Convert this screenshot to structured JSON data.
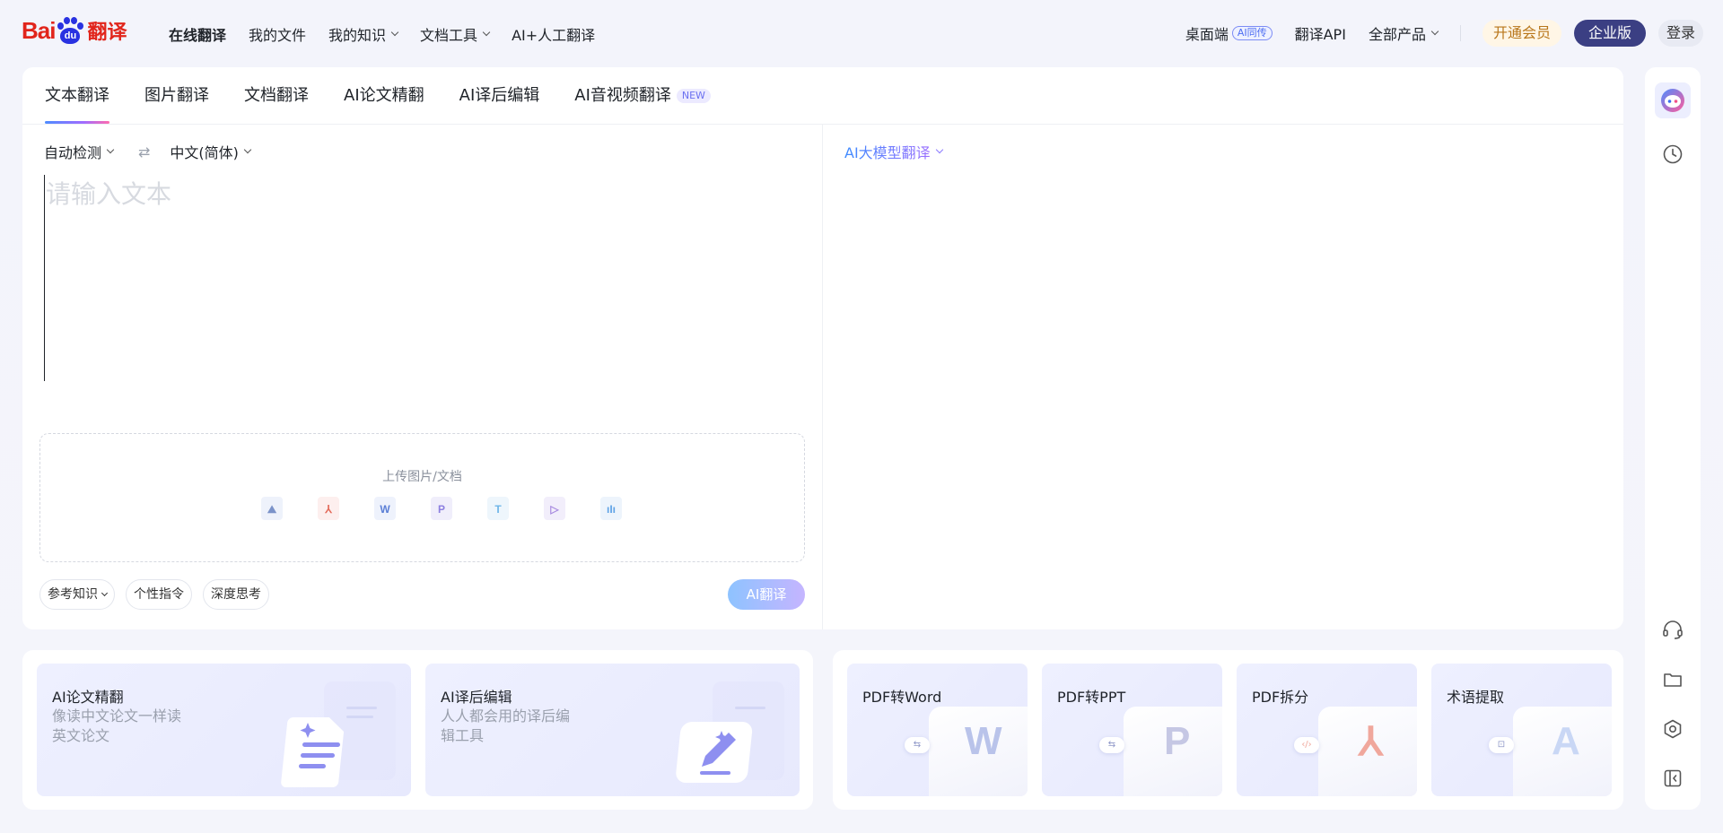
{
  "header": {
    "logo": {
      "bai": "Bai",
      "du": "du",
      "trans": "翻译"
    },
    "nav": [
      {
        "label": "在线翻译",
        "active": true,
        "dropdown": false
      },
      {
        "label": "我的文件",
        "active": false,
        "dropdown": false
      },
      {
        "label": "我的知识",
        "active": false,
        "dropdown": true
      },
      {
        "label": "文档工具",
        "active": false,
        "dropdown": true
      },
      {
        "label": "AI+人工翻译",
        "active": false,
        "dropdown": false
      }
    ],
    "desktop": "桌面端",
    "desktop_badge": "AI同传",
    "api": "翻译API",
    "all_products": "全部产品",
    "vip": "开通会员",
    "enterprise": "企业版",
    "login": "登录"
  },
  "tabs": [
    {
      "label": "文本翻译",
      "active": true
    },
    {
      "label": "图片翻译",
      "active": false
    },
    {
      "label": "文档翻译",
      "active": false
    },
    {
      "label": "AI论文精翻",
      "active": false
    },
    {
      "label": "AI译后编辑",
      "active": false
    },
    {
      "label": "AI音视频翻译",
      "active": false,
      "badge": "NEW"
    }
  ],
  "source": {
    "lang_from": "自动检测",
    "lang_to": "中文(简体)",
    "placeholder": "请输入文本",
    "value": ""
  },
  "target": {
    "model": "AI大模型翻译"
  },
  "upload": {
    "title": "上传图片/文档",
    "icons": [
      {
        "name": "image-file-icon",
        "glyph": "⛰",
        "color": "#7b93c9",
        "bg": "#eef2fb"
      },
      {
        "name": "pdf-file-icon",
        "glyph": "⅄",
        "color": "#e36a5a",
        "bg": "#fdefee"
      },
      {
        "name": "word-file-icon",
        "glyph": "W",
        "color": "#5b7fd6",
        "bg": "#eef2fc"
      },
      {
        "name": "ppt-file-icon",
        "glyph": "P",
        "color": "#8c7fe0",
        "bg": "#f0eefb"
      },
      {
        "name": "txt-file-icon",
        "glyph": "T",
        "color": "#6fb6e8",
        "bg": "#eef6fc"
      },
      {
        "name": "video-file-icon",
        "glyph": "▷",
        "color": "#a88be0",
        "bg": "#f2eefb"
      },
      {
        "name": "audio-file-icon",
        "glyph": "ıIı",
        "color": "#5fa3e6",
        "bg": "#edf4fc"
      }
    ]
  },
  "chips": [
    {
      "label": "参考知识",
      "dropdown": true
    },
    {
      "label": "个性指令",
      "dropdown": false
    },
    {
      "label": "深度思考",
      "dropdown": false
    }
  ],
  "translate_button": "AI翻译",
  "bottom_cards_left": [
    {
      "title": "AI论文精翻",
      "desc": "像读中文论文一样读英文论文"
    },
    {
      "title": "AI译后编辑",
      "desc": "人人都会用的译后编辑工具"
    }
  ],
  "bottom_cards_right": [
    {
      "title": "PDF转Word",
      "letter": "W",
      "letter_color": "#b9c3ea"
    },
    {
      "title": "PDF转PPT",
      "letter": "P",
      "letter_color": "#c5c7e4"
    },
    {
      "title": "PDF拆分",
      "letter": "⅄",
      "letter_color": "#f0a79c"
    },
    {
      "title": "术语提取",
      "letter": "A",
      "letter_color": "#c9d7f5"
    }
  ],
  "sidebar": [
    "assistant-avatar-icon",
    "history-clock-icon",
    "customer-service-headset-icon",
    "folder-icon",
    "settings-hexagon-icon",
    "collapse-panel-icon"
  ]
}
